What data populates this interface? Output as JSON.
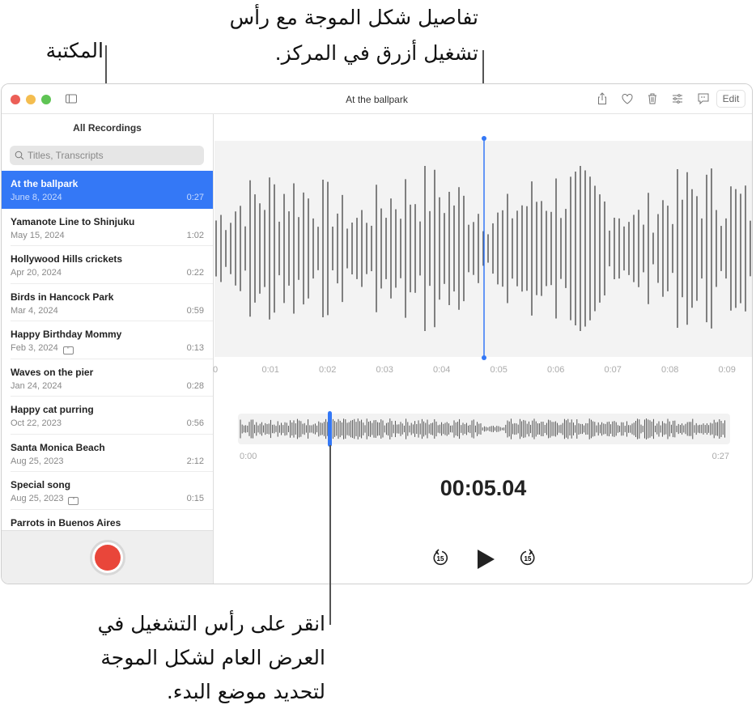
{
  "callouts": {
    "library": "المكتبة",
    "waveform_lines": [
      "تفاصيل شكل الموجة مع رأس",
      "تشغيل أزرق في المركز."
    ],
    "overview_lines": [
      "انقر على رأس التشغيل في",
      "العرض العام لشكل الموجة",
      "لتحديد موضع البدء."
    ]
  },
  "window": {
    "title": "At the ballpark",
    "edit_label": "Edit",
    "toolbar_icons": [
      "share-icon",
      "heart-icon",
      "trash-icon",
      "sliders-icon",
      "transcript-icon"
    ]
  },
  "sidebar": {
    "title": "All Recordings",
    "search_placeholder": "Titles, Transcripts",
    "items": [
      {
        "name": "At the ballpark",
        "date": "June 8, 2024",
        "duration": "0:27",
        "selected": true
      },
      {
        "name": "Yamanote Line to Shinjuku",
        "date": "May 15, 2024",
        "duration": "1:02"
      },
      {
        "name": "Hollywood Hills crickets",
        "date": "Apr 20, 2024",
        "duration": "0:22"
      },
      {
        "name": "Birds in Hancock Park",
        "date": "Mar 4, 2024",
        "duration": "0:59"
      },
      {
        "name": "Happy Birthday Mommy",
        "date": "Feb 3, 2024",
        "duration": "0:13",
        "transcript": true
      },
      {
        "name": "Waves on the pier",
        "date": "Jan 24, 2024",
        "duration": "0:28"
      },
      {
        "name": "Happy cat purring",
        "date": "Oct 22, 2023",
        "duration": "0:56"
      },
      {
        "name": "Santa Monica Beach",
        "date": "Aug 25, 2023",
        "duration": "2:12"
      },
      {
        "name": "Special song",
        "date": "Aug 25, 2023",
        "duration": "0:15",
        "transcript": true
      },
      {
        "name": "Parrots in Buenos Aires",
        "date": "",
        "duration": ""
      }
    ]
  },
  "player": {
    "time_ticks": [
      "0",
      "0:01",
      "0:02",
      "0:03",
      "0:04",
      "0:05",
      "0:06",
      "0:07",
      "0:08",
      "0:09"
    ],
    "overview_start": "0:00",
    "overview_end": "0:27",
    "current_time": "00:05.04",
    "playhead_seconds": 5.04,
    "duration_seconds": 27,
    "accent": "#3478f6",
    "record_color": "#e9463a"
  }
}
